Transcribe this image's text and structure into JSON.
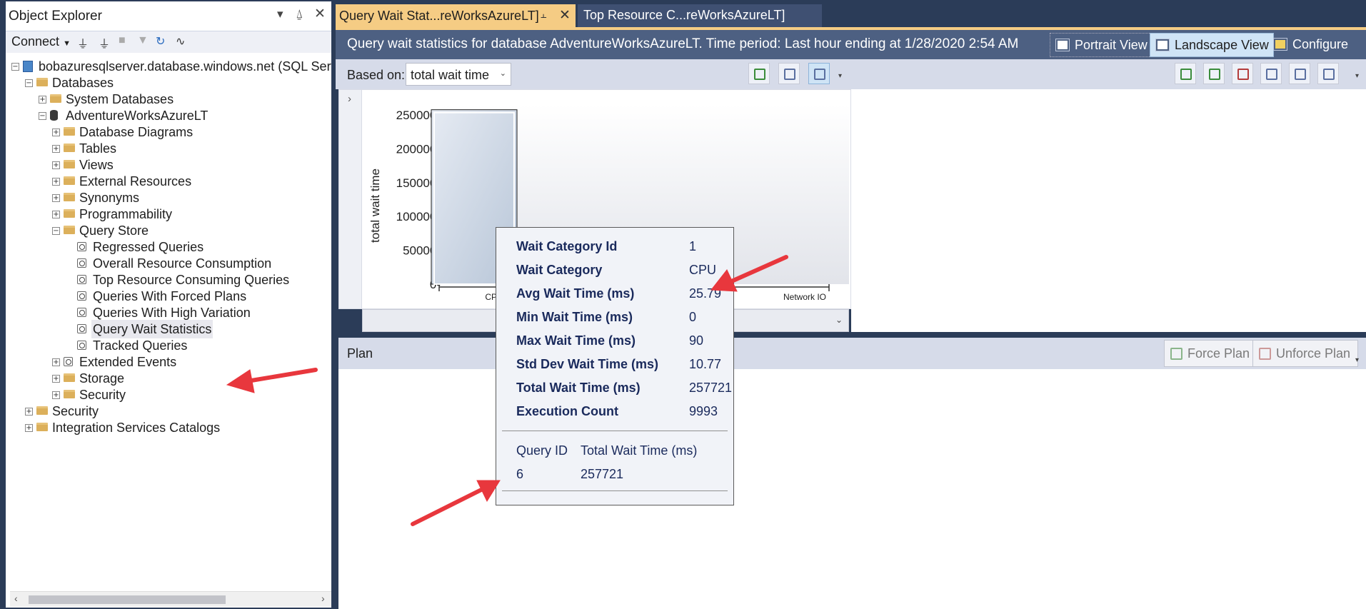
{
  "object_explorer": {
    "title": "Object Explorer",
    "connect_label": "Connect",
    "tree": [
      {
        "label": "bobazuresqlserver.database.windows.net (SQL Server",
        "level": 0,
        "icon": "server-icon",
        "expand": "minus"
      },
      {
        "label": "Databases",
        "level": 1,
        "icon": "folder-icon",
        "expand": "minus"
      },
      {
        "label": "System Databases",
        "level": 2,
        "icon": "folder-icon",
        "expand": "plus"
      },
      {
        "label": "AdventureWorksAzureLT",
        "level": 2,
        "icon": "database-icon",
        "expand": "minus"
      },
      {
        "label": "Database Diagrams",
        "level": 3,
        "icon": "folder-icon",
        "expand": "plus"
      },
      {
        "label": "Tables",
        "level": 3,
        "icon": "folder-icon",
        "expand": "plus"
      },
      {
        "label": "Views",
        "level": 3,
        "icon": "folder-icon",
        "expand": "plus"
      },
      {
        "label": "External Resources",
        "level": 3,
        "icon": "folder-icon",
        "expand": "plus"
      },
      {
        "label": "Synonyms",
        "level": 3,
        "icon": "folder-icon",
        "expand": "plus"
      },
      {
        "label": "Programmability",
        "level": 3,
        "icon": "folder-icon",
        "expand": "plus"
      },
      {
        "label": "Query Store",
        "level": 3,
        "icon": "folder-icon",
        "expand": "minus"
      },
      {
        "label": "Regressed Queries",
        "level": 4,
        "icon": "query-report-icon",
        "expand": "none"
      },
      {
        "label": "Overall Resource Consumption",
        "level": 4,
        "icon": "query-report-icon",
        "expand": "none"
      },
      {
        "label": "Top Resource Consuming Queries",
        "level": 4,
        "icon": "query-report-icon",
        "expand": "none"
      },
      {
        "label": "Queries With Forced Plans",
        "level": 4,
        "icon": "query-report-icon",
        "expand": "none"
      },
      {
        "label": "Queries With High Variation",
        "level": 4,
        "icon": "query-report-icon",
        "expand": "none"
      },
      {
        "label": "Query Wait Statistics",
        "level": 4,
        "icon": "query-report-icon",
        "expand": "none",
        "selected": true
      },
      {
        "label": "Tracked Queries",
        "level": 4,
        "icon": "query-report-icon",
        "expand": "none"
      },
      {
        "label": "Extended Events",
        "level": 3,
        "icon": "extended-events-icon",
        "expand": "plus"
      },
      {
        "label": "Storage",
        "level": 3,
        "icon": "folder-icon",
        "expand": "plus"
      },
      {
        "label": "Security",
        "level": 3,
        "icon": "folder-icon",
        "expand": "plus"
      },
      {
        "label": "Security",
        "level": 1,
        "icon": "folder-icon",
        "expand": "plus"
      },
      {
        "label": "Integration Services Catalogs",
        "level": 1,
        "icon": "folder-icon",
        "expand": "plus"
      }
    ]
  },
  "tabs": [
    {
      "label": "Query Wait Stat...reWorksAzureLT]",
      "active": true
    },
    {
      "label": "Top Resource C...reWorksAzureLT]",
      "active": false
    }
  ],
  "header": {
    "title": "Query wait statistics for database AdventureWorksAzureLT. Time period: Last hour ending at 1/28/2020 2:54 AM",
    "portrait_label": "Portrait View",
    "landscape_label": "Landscape View",
    "configure_label": "Configure"
  },
  "subbar": {
    "based_on_label": "Based on:",
    "based_on_value": "total wait time"
  },
  "plan": {
    "title": "Plan",
    "force_label": "Force Plan",
    "unforce_label": "Unforce Plan"
  },
  "chart_data": {
    "type": "bar",
    "categories": [
      "CPU",
      "Network IO"
    ],
    "values": [
      257721,
      0
    ],
    "ylabel": "total wait time",
    "yticks": [
      "250000-",
      "200000-",
      "150000-",
      "100000-",
      "50000-",
      "0-"
    ],
    "ylim": [
      0,
      260000
    ],
    "colors": {
      "bar": "#cbd5e3",
      "bar_edge": "#1e1e1e"
    }
  },
  "tooltip": {
    "rows": [
      {
        "key": "Wait Category Id",
        "value": "1"
      },
      {
        "key": "Wait Category",
        "value": "CPU"
      },
      {
        "key": "Avg Wait Time (ms)",
        "value": "25.79"
      },
      {
        "key": "Min Wait Time (ms)",
        "value": "0"
      },
      {
        "key": "Max Wait Time (ms)",
        "value": "90"
      },
      {
        "key": "Std Dev Wait Time (ms)",
        "value": "10.77"
      },
      {
        "key": "Total Wait Time (ms)",
        "value": "257721"
      },
      {
        "key": "Execution Count",
        "value": "9993"
      }
    ],
    "query_header": {
      "id": "Query ID",
      "total": "Total Wait Time (ms)"
    },
    "query_row": {
      "id": "6",
      "total": "257721"
    }
  },
  "colors": {
    "frame": "#2b3c58",
    "active_tab": "#f5cc84",
    "header": "#4d6082",
    "arrow": "#e8373d"
  }
}
